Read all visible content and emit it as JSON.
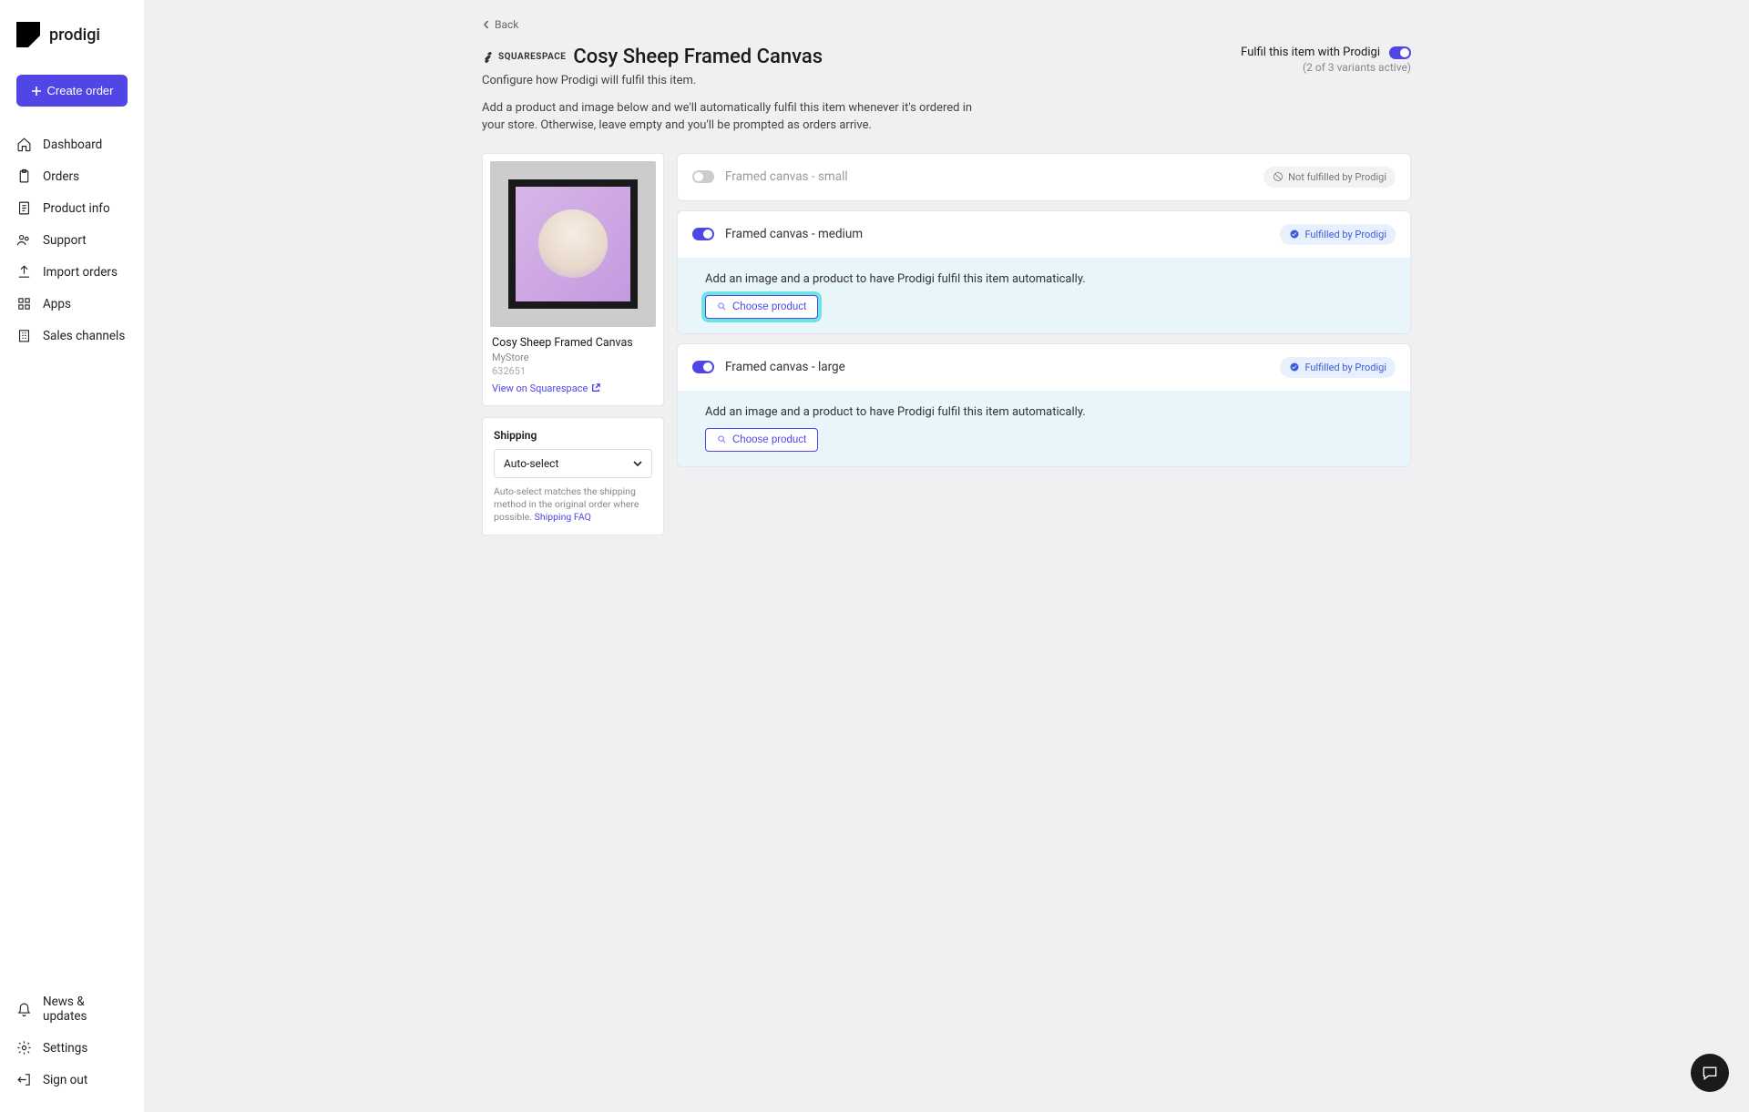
{
  "brand": "prodigi",
  "create_order": "Create order",
  "nav": {
    "dashboard": "Dashboard",
    "orders": "Orders",
    "product_info": "Product info",
    "support": "Support",
    "import_orders": "Import orders",
    "apps": "Apps",
    "sales_channels": "Sales channels",
    "news": "News & updates",
    "settings": "Settings",
    "sign_out": "Sign out"
  },
  "back": "Back",
  "platform_badge": "SQUARESPACE",
  "title": "Cosy Sheep Framed Canvas",
  "subtitle": "Configure how Prodigi will fulfil this item.",
  "description": "Add a product and image below and we'll automatically fulfil this item whenever it's ordered in your store. Otherwise, leave empty and you'll be prompted as orders arrive.",
  "fulfil_label": "Fulfil this item with Prodigi",
  "fulfil_sub": "(2 of 3 variants active)",
  "product": {
    "name": "Cosy Sheep Framed Canvas",
    "store": "MyStore",
    "id": "632651",
    "view_link": "View on Squarespace"
  },
  "shipping": {
    "title": "Shipping",
    "selected": "Auto-select",
    "hint": "Auto-select matches the shipping method in the original order where possible. ",
    "faq": "Shipping FAQ"
  },
  "status": {
    "not_fulfilled": "Not fulfilled by Prodigi",
    "fulfilled": "Fulfilled by Prodigi"
  },
  "variant_body": {
    "text": "Add an image and a product to have Prodigi fulfil this item automatically.",
    "choose": "Choose product"
  },
  "variants": [
    {
      "name": "Framed canvas - small",
      "on": false
    },
    {
      "name": "Framed canvas - medium",
      "on": true,
      "highlight": true
    },
    {
      "name": "Framed canvas - large",
      "on": true
    }
  ]
}
